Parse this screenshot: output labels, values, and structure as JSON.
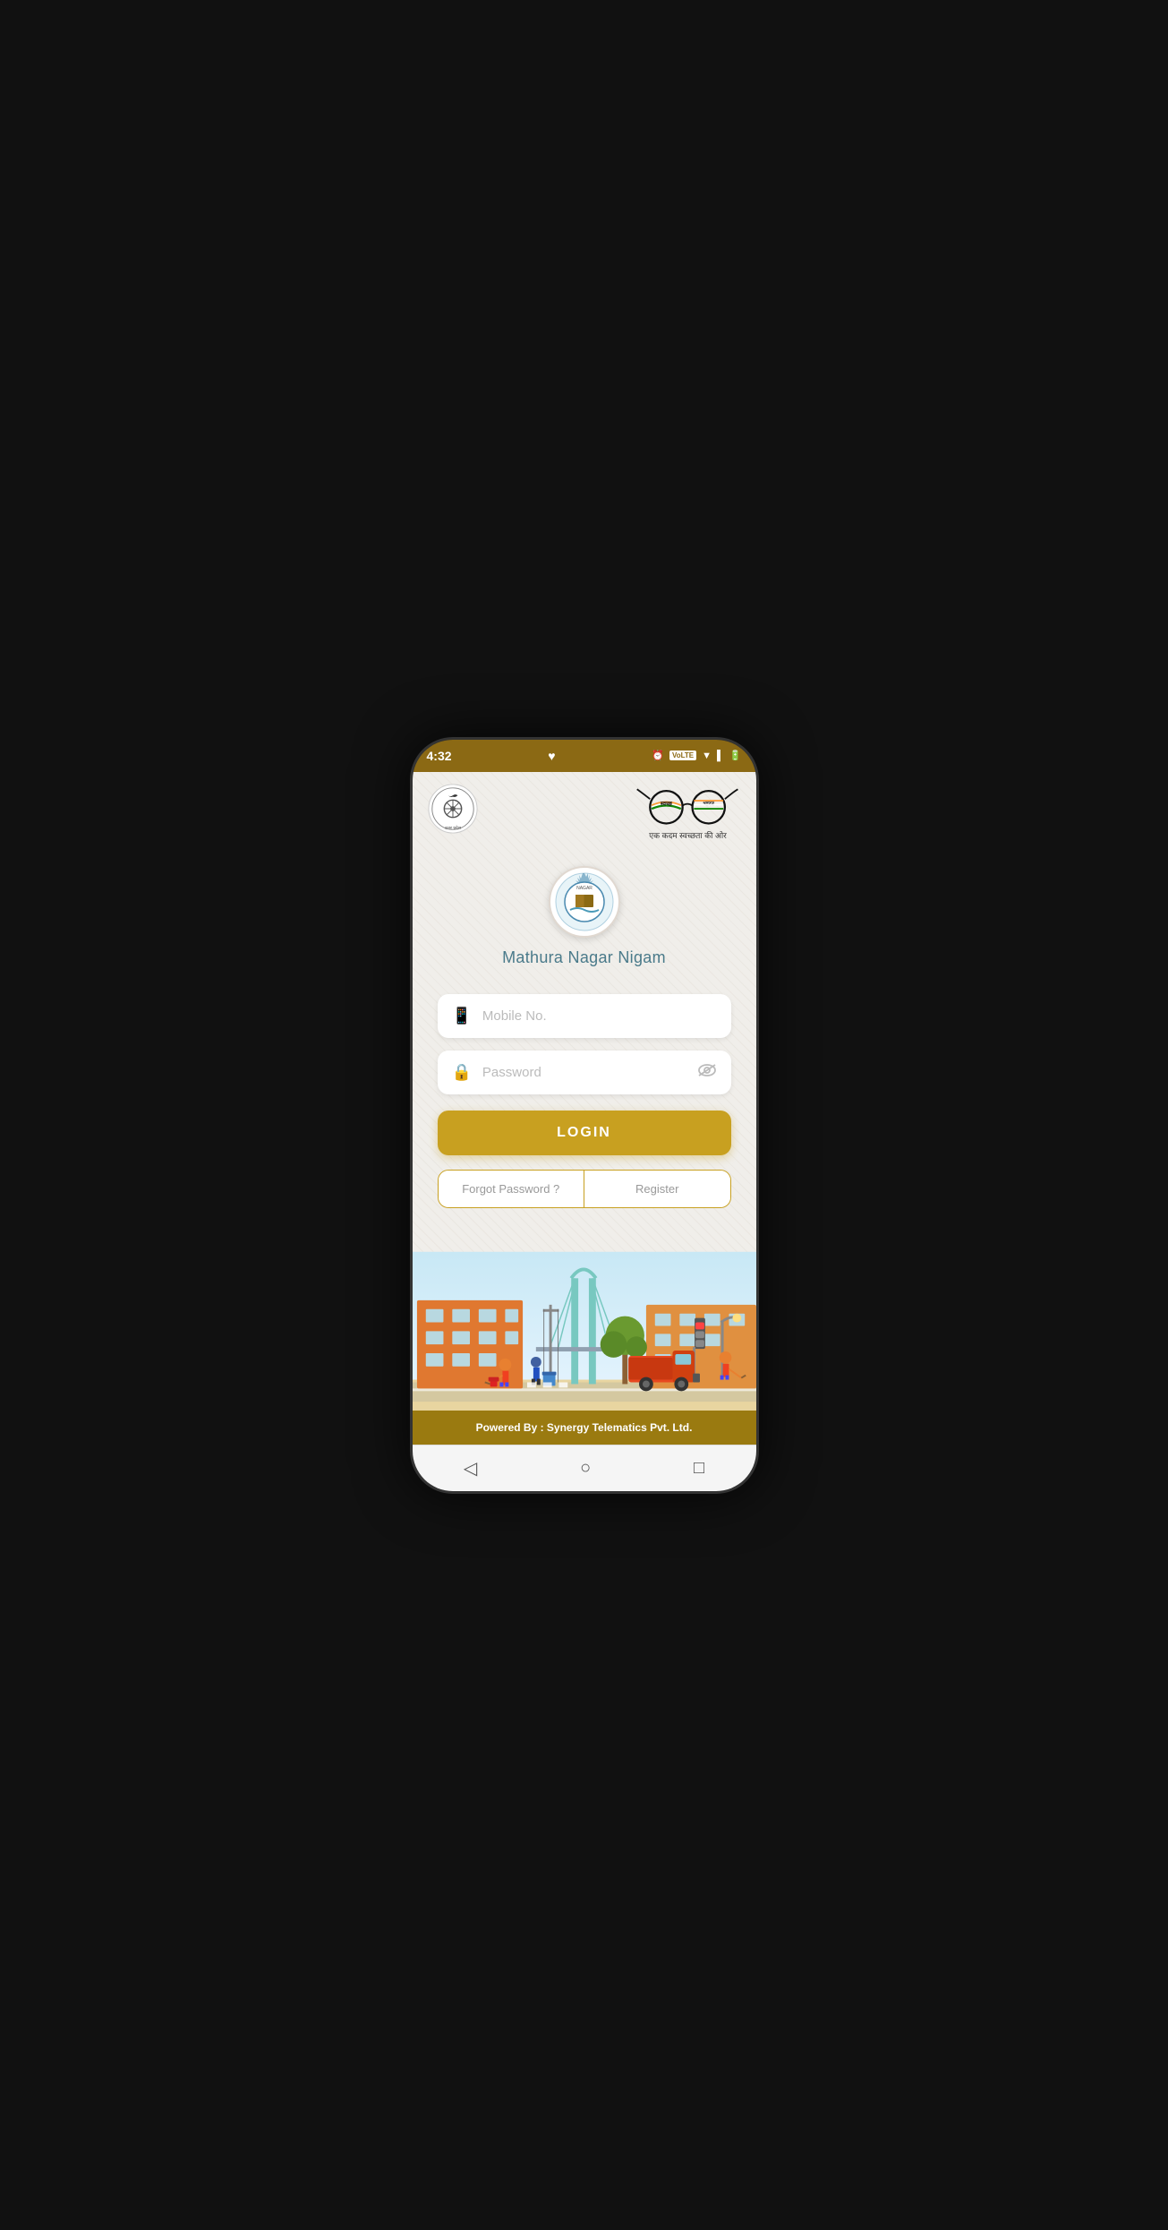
{
  "statusBar": {
    "time": "4:32",
    "heartIcon": "♥",
    "volteBadge": "VoLTE",
    "icons": [
      "alarm",
      "volte",
      "wifi",
      "signal",
      "battery"
    ]
  },
  "header": {
    "swachhTagline": "एक कदम स्वच्छता की ओर"
  },
  "app": {
    "name": "Mathura Nagar Nigam"
  },
  "form": {
    "mobileLabel": "Mobile No.",
    "mobilePlaceholder": "Mobile No.",
    "passwordLabel": "Password",
    "passwordPlaceholder": "Password",
    "loginButton": "LOGIN",
    "forgotPassword": "Forgot Password ?",
    "register": "Register"
  },
  "footer": {
    "poweredBy": "Powered By : Synergy Telematics Pvt. Ltd."
  },
  "colors": {
    "accent": "#c8a020",
    "header": "#8B6914",
    "teal": "#4a7a8a"
  }
}
